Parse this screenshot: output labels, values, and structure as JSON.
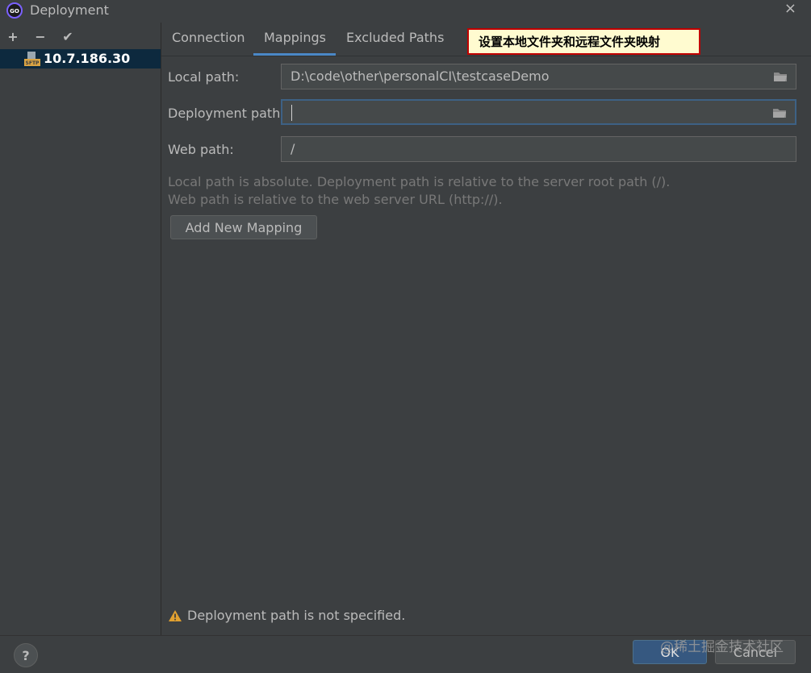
{
  "window": {
    "title": "Deployment",
    "close_label": "×"
  },
  "toolbar": {
    "add": "+",
    "remove": "−",
    "apply": "✔"
  },
  "servers": [
    {
      "name": "10.7.186.30",
      "type_badge": "SFTP"
    }
  ],
  "tabs": [
    {
      "label": "Connection"
    },
    {
      "label": "Mappings",
      "selected": true
    },
    {
      "label": "Excluded Paths"
    }
  ],
  "annotation": "设置本地文件夹和远程文件夹映射",
  "mapping": {
    "local_label": "Local path:",
    "local_value": "D:\\code\\other\\personalCI\\testcaseDemo",
    "deployment_label": "Deployment path:",
    "deployment_value": "",
    "web_label": "Web path:",
    "web_value": "/"
  },
  "hints": {
    "line1": "Local path is absolute. Deployment path is relative to the server root path (/).",
    "line2": "Web path is relative to the web server URL (http://)."
  },
  "add_mapping_button": "Add New Mapping",
  "warning": "Deployment path is not specified.",
  "footer": {
    "help": "?",
    "ok": "OK",
    "cancel": "Cancel",
    "watermark": "@稀土掘金技术社区"
  },
  "colors": {
    "accent": "#4a88c7",
    "selection": "#0d293e",
    "callout_border": "#c00000",
    "warning": "#e0a030"
  },
  "icons": [
    "app-logo-icon",
    "close-icon",
    "add-icon",
    "remove-icon",
    "check-icon",
    "sftp-server-icon",
    "folder-icon",
    "warning-icon",
    "help-icon"
  ]
}
